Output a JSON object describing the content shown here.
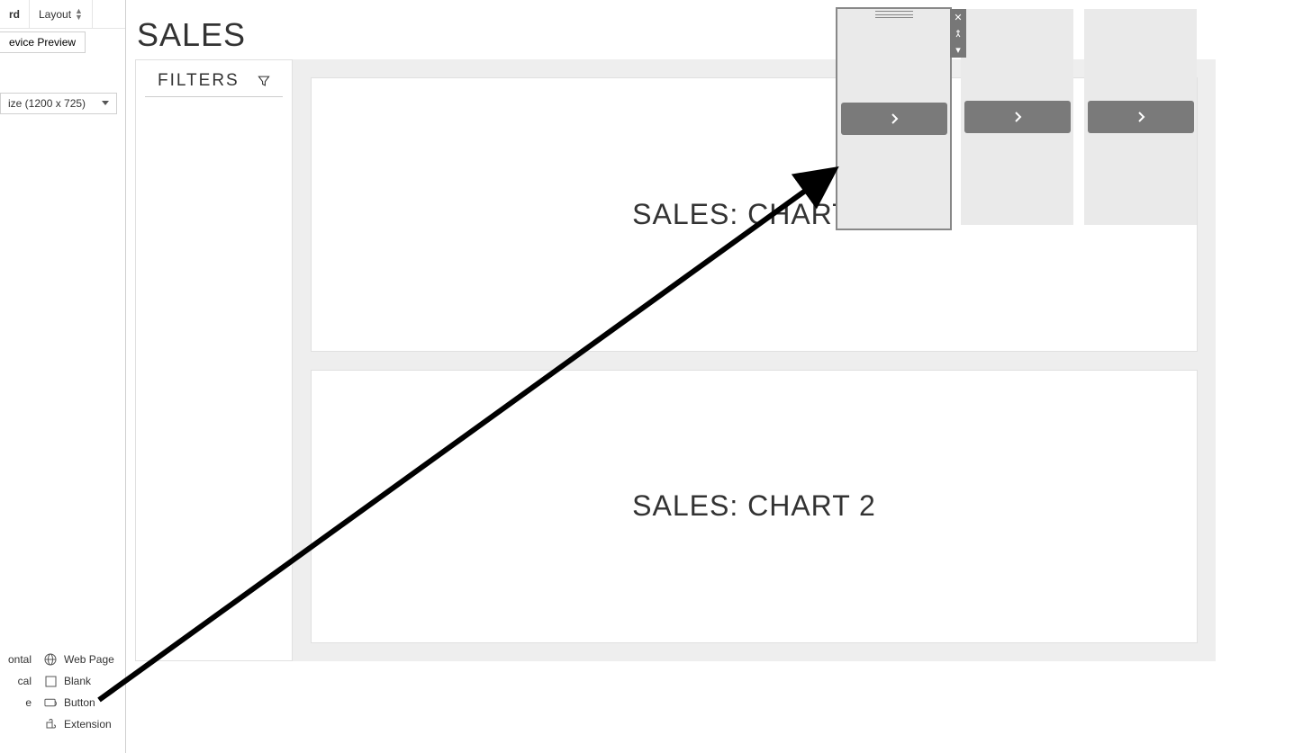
{
  "left_panel": {
    "tabs": {
      "dashboard": "rd",
      "layout": "Layout"
    },
    "device_preview": "evice Preview",
    "size_label": "ize (1200 x 725)"
  },
  "objects": {
    "horizontal": "ontal",
    "vertical": "cal",
    "e_item": "e",
    "web_page": "Web Page",
    "blank": "Blank",
    "button": "Button",
    "extension": "Extension"
  },
  "dashboard": {
    "title": "SALES",
    "filters_label": "FILTERS",
    "chart1": "SALES: CHART 1",
    "chart2": "SALES: CHART 2"
  }
}
